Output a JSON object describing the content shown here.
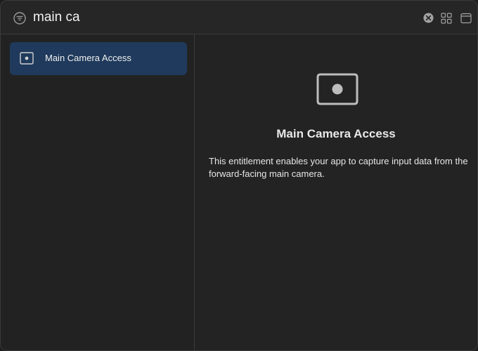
{
  "search": {
    "value": "main ca",
    "filter_icon": "filter-circle-icon",
    "clear_icon": "clear-x-circle-icon",
    "view_icons": [
      "grid-view-icon",
      "window-view-icon"
    ]
  },
  "sidebar": {
    "items": [
      {
        "label": "Main Camera Access",
        "icon": "camera-viewfinder-icon",
        "selected": true
      }
    ]
  },
  "detail": {
    "icon": "camera-viewfinder-icon",
    "title": "Main Camera Access",
    "description": "This entitlement enables your app to capture input data from the forward-facing main camera."
  },
  "colors": {
    "background": "#232323",
    "selection": "#1f3a5c",
    "text": "#f0f0f0"
  }
}
